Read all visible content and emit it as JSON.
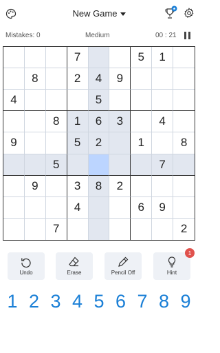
{
  "header": {
    "title": "New Game"
  },
  "info": {
    "mistakes": "Mistakes: 0",
    "difficulty": "Medium",
    "time": "00 : 21"
  },
  "board": [
    [
      "",
      "",
      "",
      "7",
      "",
      "",
      "5",
      "1",
      ""
    ],
    [
      "",
      "8",
      "",
      "2",
      "4",
      "9",
      "",
      "",
      ""
    ],
    [
      "4",
      "",
      "",
      "",
      "5",
      "",
      "",
      "",
      ""
    ],
    [
      "",
      "",
      "8",
      "1",
      "6",
      "3",
      "",
      "4",
      ""
    ],
    [
      "9",
      "",
      "",
      "5",
      "2",
      "",
      "1",
      "",
      "8"
    ],
    [
      "",
      "",
      "5",
      "",
      "",
      "",
      "",
      "7",
      ""
    ],
    [
      "",
      "9",
      "",
      "3",
      "8",
      "2",
      "",
      "",
      ""
    ],
    [
      "",
      "",
      "",
      "4",
      "",
      "",
      "6",
      "9",
      ""
    ],
    [
      "",
      "",
      "7",
      "",
      "",
      "",
      "",
      "",
      "2"
    ]
  ],
  "selected": {
    "row": 5,
    "col": 4
  },
  "tools": {
    "undo": "Undo",
    "erase": "Erase",
    "pencil": "Pencil Off",
    "hint": "Hint",
    "hint_count": "1"
  },
  "numbers": [
    "1",
    "2",
    "3",
    "4",
    "5",
    "6",
    "7",
    "8",
    "9"
  ],
  "colors": {
    "accent": "#1a7fd6",
    "highlight": "#e2e7f0",
    "selected": "#bcd5ff",
    "badge": "#e0524d"
  }
}
